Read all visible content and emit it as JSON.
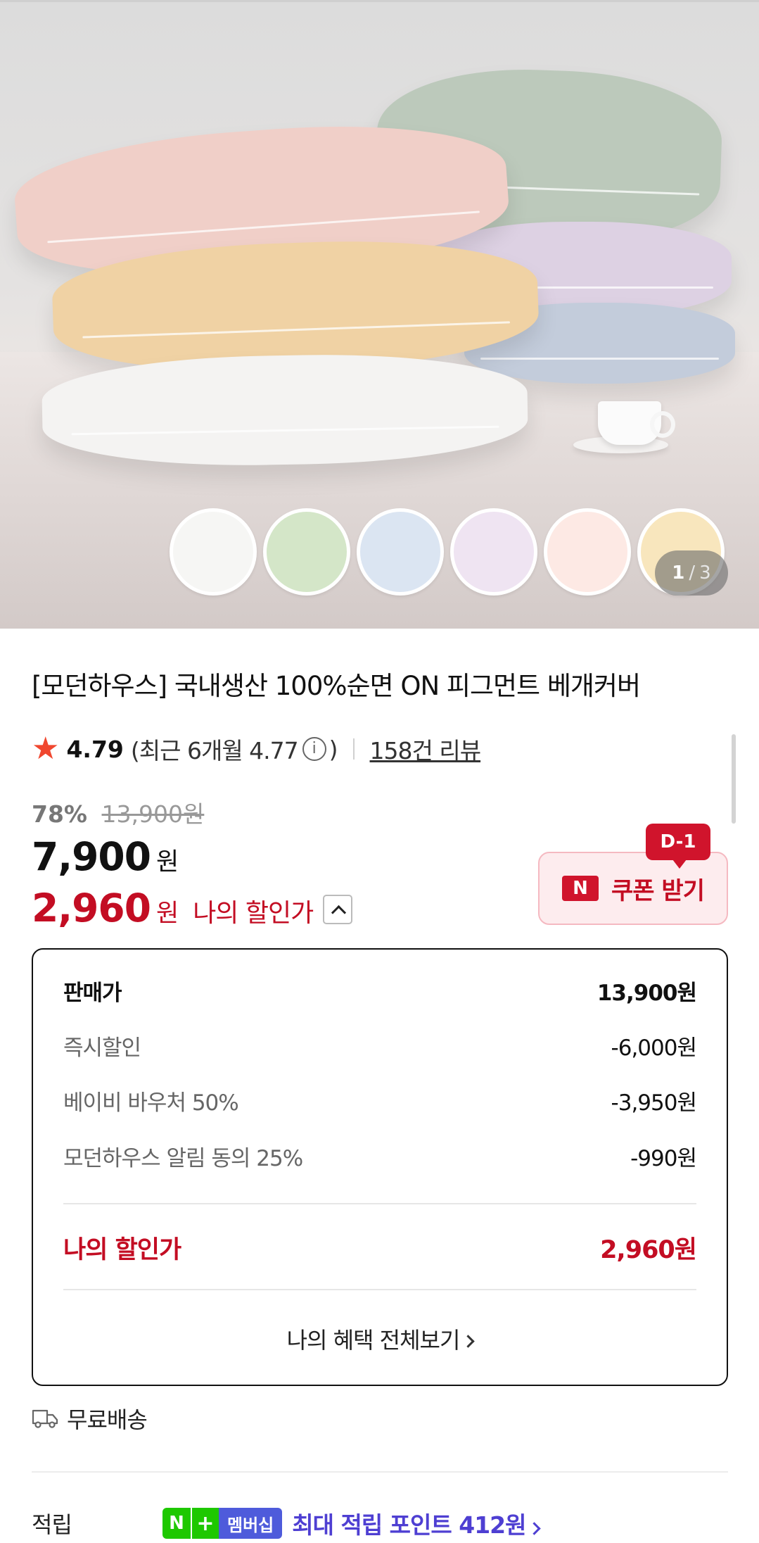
{
  "gallery": {
    "swatch_colors": [
      "#f6f6f4",
      "#d4e6c8",
      "#dbe5f2",
      "#efe4f2",
      "#fde9e4",
      "#f8e6bd"
    ],
    "counter_current": "1",
    "counter_sep": "/",
    "counter_total": "3"
  },
  "product": {
    "title": "[모던하우스] 국내생산 100%순면 ON 피그먼트 베개커버"
  },
  "rating": {
    "score": "4.79",
    "recent_prefix": "(최근 6개월 4.77",
    "info_icon": "i",
    "recent_suffix": ")",
    "reviews_link": "158건 리뷰"
  },
  "price": {
    "discount_pct": "78%",
    "original": "13,900원",
    "sale": "7,900",
    "sale_unit": "원",
    "my_price": "2,960",
    "my_price_unit": "원",
    "my_price_label": "나의 할인가"
  },
  "coupon": {
    "badge": "D-1",
    "icon_letter": "N",
    "label": "쿠폰 받기"
  },
  "breakdown": {
    "rows": [
      {
        "label": "판매가",
        "value": "13,900원"
      },
      {
        "label": "즉시할인",
        "value": "-6,000원"
      },
      {
        "label": "베이비 바우처 50%",
        "value": "-3,950원"
      },
      {
        "label": "모던하우스 알림 동의 25%",
        "value": "-990원"
      }
    ],
    "total_label": "나의 할인가",
    "total_value": "2,960원",
    "all_benefits": "나의 혜택 전체보기"
  },
  "shipping": {
    "label": "무료배송"
  },
  "points": {
    "label": "적립",
    "n_letter": "N",
    "plus": "+",
    "membership": "멤버십",
    "text": "최대 적립 포인트 412원"
  },
  "colors": {
    "accent_red": "#c30d23",
    "star": "#f0472f",
    "naver_green": "#1ec800",
    "membership_purple": "#4e3fd2"
  }
}
